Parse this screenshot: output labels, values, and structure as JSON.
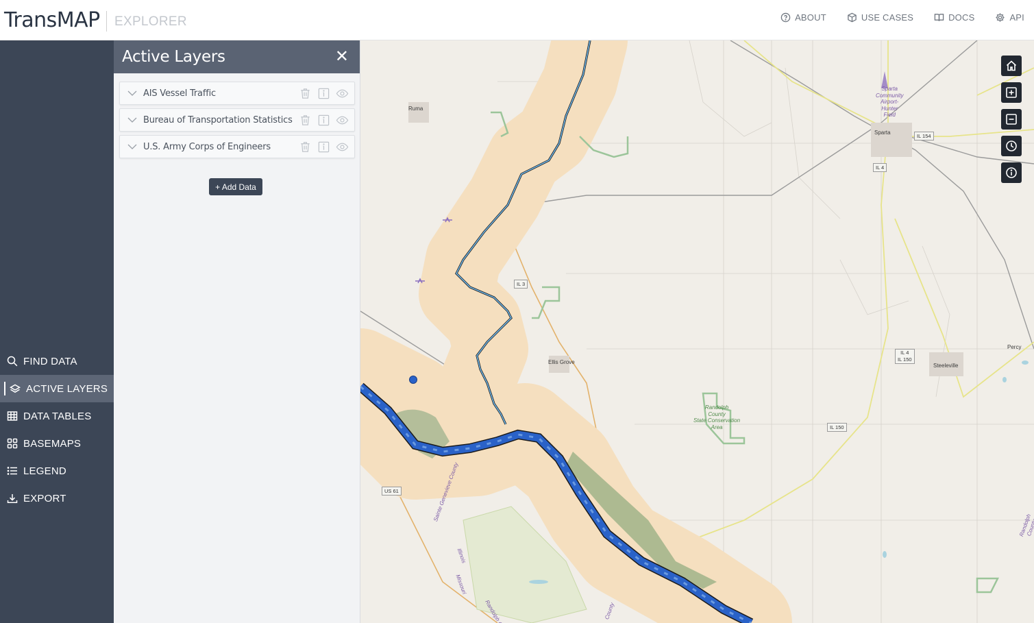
{
  "header": {
    "brand": "TransMAP",
    "subtitle": "EXPLORER",
    "nav": [
      {
        "label": "ABOUT",
        "icon": "question-circle-icon"
      },
      {
        "label": "USE CASES",
        "icon": "cube-icon"
      },
      {
        "label": "DOCS",
        "icon": "book-icon"
      },
      {
        "label": "API",
        "icon": "gear-icon"
      }
    ]
  },
  "sidebar": {
    "items": [
      {
        "label": "FIND DATA",
        "icon": "search-icon",
        "active": false
      },
      {
        "label": "ACTIVE LAYERS",
        "icon": "layers-icon",
        "active": true
      },
      {
        "label": "DATA TABLES",
        "icon": "table-icon",
        "active": false
      },
      {
        "label": "BASEMAPS",
        "icon": "grid-icon",
        "active": false
      },
      {
        "label": "LEGEND",
        "icon": "list-icon",
        "active": false
      },
      {
        "label": "EXPORT",
        "icon": "download-icon",
        "active": false
      }
    ]
  },
  "panel": {
    "title": "Active Layers",
    "close_symbol": "✕",
    "layers": [
      {
        "name": "AIS Vessel Traffic"
      },
      {
        "name": "Bureau of Transportation Statistics"
      },
      {
        "name": "U.S. Army Corps of Engineers"
      }
    ],
    "add_button": "+ Add Data"
  },
  "map": {
    "controls": [
      "home-icon",
      "zoom-in-icon",
      "zoom-out-icon",
      "clock-icon",
      "info-icon"
    ],
    "places": {
      "ruma": "Ruma",
      "sparta": "Sparta",
      "ellis_grove": "Ellis Grove",
      "steeleville": "Steeleville",
      "percy": "Percy"
    },
    "airport": [
      "Sparta",
      "Community",
      "Airport-",
      "Hunter",
      "Field"
    ],
    "park": [
      "Randolph",
      "County",
      "State Conservation",
      "Area"
    ],
    "shields": {
      "il154": "IL 154",
      "il4_top": "IL 4",
      "il3": "IL 3",
      "il4_il150": [
        "IL 4",
        "IL 150"
      ],
      "il150": "IL 150",
      "us61": "US 61"
    },
    "boundaries": {
      "ste_genevieve": "Sainte Genevieve County",
      "illinois": "Illinois",
      "missouri": "Missouri",
      "randolph_co": "Randolph Co",
      "county": "County",
      "randolph_right": "Randolph County"
    },
    "colors": {
      "buffer": "#f5dfbf",
      "river": "#2f6fd0",
      "ais": "#2a62c8",
      "land": "#f1eee8",
      "park": "#9cc59a"
    }
  }
}
